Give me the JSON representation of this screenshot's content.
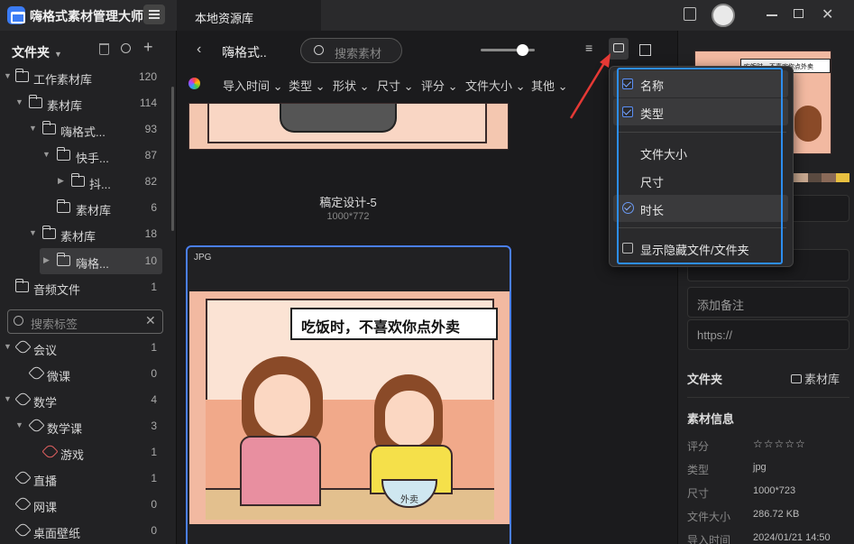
{
  "titlebar": {
    "app_name": "嗨格式素材管理大师",
    "tab": "本地资源库"
  },
  "sidebar": {
    "header": "文件夹",
    "folders": [
      {
        "label": "工作素材库",
        "count": "120"
      },
      {
        "label": "素材库",
        "count": "114"
      },
      {
        "label": "嗨格式...",
        "count": "93"
      },
      {
        "label": "快手...",
        "count": "87"
      },
      {
        "label": "抖...",
        "count": "82"
      },
      {
        "label": "素材库",
        "count": "6"
      },
      {
        "label": "素材库",
        "count": "18"
      },
      {
        "label": "嗨格...",
        "count": "10"
      },
      {
        "label": "音频文件",
        "count": "1"
      }
    ],
    "tag_search_placeholder": "搜索标签",
    "tags": [
      {
        "label": "会议",
        "count": "1"
      },
      {
        "label": "微课",
        "count": "0"
      },
      {
        "label": "数学",
        "count": "4"
      },
      {
        "label": "数学课",
        "count": "3"
      },
      {
        "label": "游戏",
        "count": "1"
      },
      {
        "label": "直播",
        "count": "1"
      },
      {
        "label": "网课",
        "count": "0"
      },
      {
        "label": "桌面壁纸",
        "count": "0"
      }
    ]
  },
  "main": {
    "breadcrumb": "嗨格式..",
    "search_placeholder": "搜索素材",
    "filters": [
      "导入时间",
      "类型",
      "形状",
      "尺寸",
      "评分",
      "文件大小",
      "其他"
    ],
    "card1": {
      "name": "稿定设计-5",
      "dims": "1000*772"
    },
    "card2": {
      "type_badge": "JPG",
      "comic_text": "吃饭时，不喜欢你点外卖",
      "bowl_text": "外卖"
    }
  },
  "dropdown": {
    "items": [
      {
        "label": "名称",
        "kind": "checkbox",
        "checked": true
      },
      {
        "label": "类型",
        "kind": "checkbox",
        "checked": true
      },
      {
        "label": "文件大小",
        "kind": "plain"
      },
      {
        "label": "尺寸",
        "kind": "plain"
      },
      {
        "label": "时长",
        "kind": "tick"
      },
      {
        "label": "显示隐藏文件/文件夹",
        "kind": "checkbox",
        "checked": false
      }
    ]
  },
  "rpanel": {
    "thumb_text": "吃饭时，不喜欢你点外卖",
    "swatches": [
      "#c8a890",
      "#5a4a40",
      "#8a6a58",
      "#e8c040"
    ],
    "note_placeholder": "添加备注",
    "url_placeholder": "https://",
    "folder_label": "文件夹",
    "folder_value": "素材库",
    "info_title": "素材信息",
    "info": [
      {
        "label": "评分",
        "value": "☆☆☆☆☆"
      },
      {
        "label": "类型",
        "value": "jpg"
      },
      {
        "label": "尺寸",
        "value": "1000*723"
      },
      {
        "label": "文件大小",
        "value": "286.72 KB"
      },
      {
        "label": "导入时间",
        "value": "2024/01/21 14:50"
      }
    ]
  },
  "colors": {
    "accent": "#2d8ef0",
    "arrow": "#e53935"
  }
}
